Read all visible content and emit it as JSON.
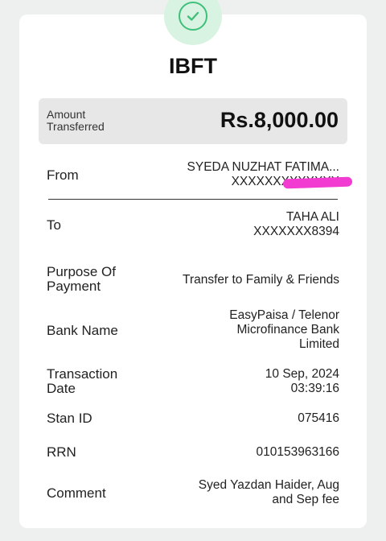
{
  "receipt": {
    "title": "IBFT",
    "amount_label": "Amount Transferred",
    "amount_value": "Rs.8,000.00",
    "status_icon": "check-circle-icon",
    "accent_color": "#3fbf7a",
    "rows": {
      "from": {
        "label": "From",
        "lines": [
          "SYEDA NUZHAT FATIMA...",
          "XXXXXXXXXXXXX"
        ]
      },
      "to": {
        "label": "To",
        "lines": [
          "TAHA ALI",
          "XXXXXXX8394"
        ]
      },
      "purpose": {
        "label": "Purpose Of Payment",
        "value": "Transfer to Family & Friends"
      },
      "bank": {
        "label": "Bank Name",
        "lines": [
          "EasyPaisa / Telenor",
          "Microfinance Bank",
          "Limited"
        ]
      },
      "date": {
        "label": "Transaction Date",
        "lines": [
          "10 Sep, 2024",
          "03:39:16"
        ]
      },
      "stan": {
        "label": "Stan ID",
        "value": "075416"
      },
      "rrn": {
        "label": "RRN",
        "value": "010153963166"
      },
      "comment": {
        "label": "Comment",
        "lines": [
          "Syed Yazdan Haider, Aug",
          "and Sep fee"
        ]
      }
    }
  }
}
